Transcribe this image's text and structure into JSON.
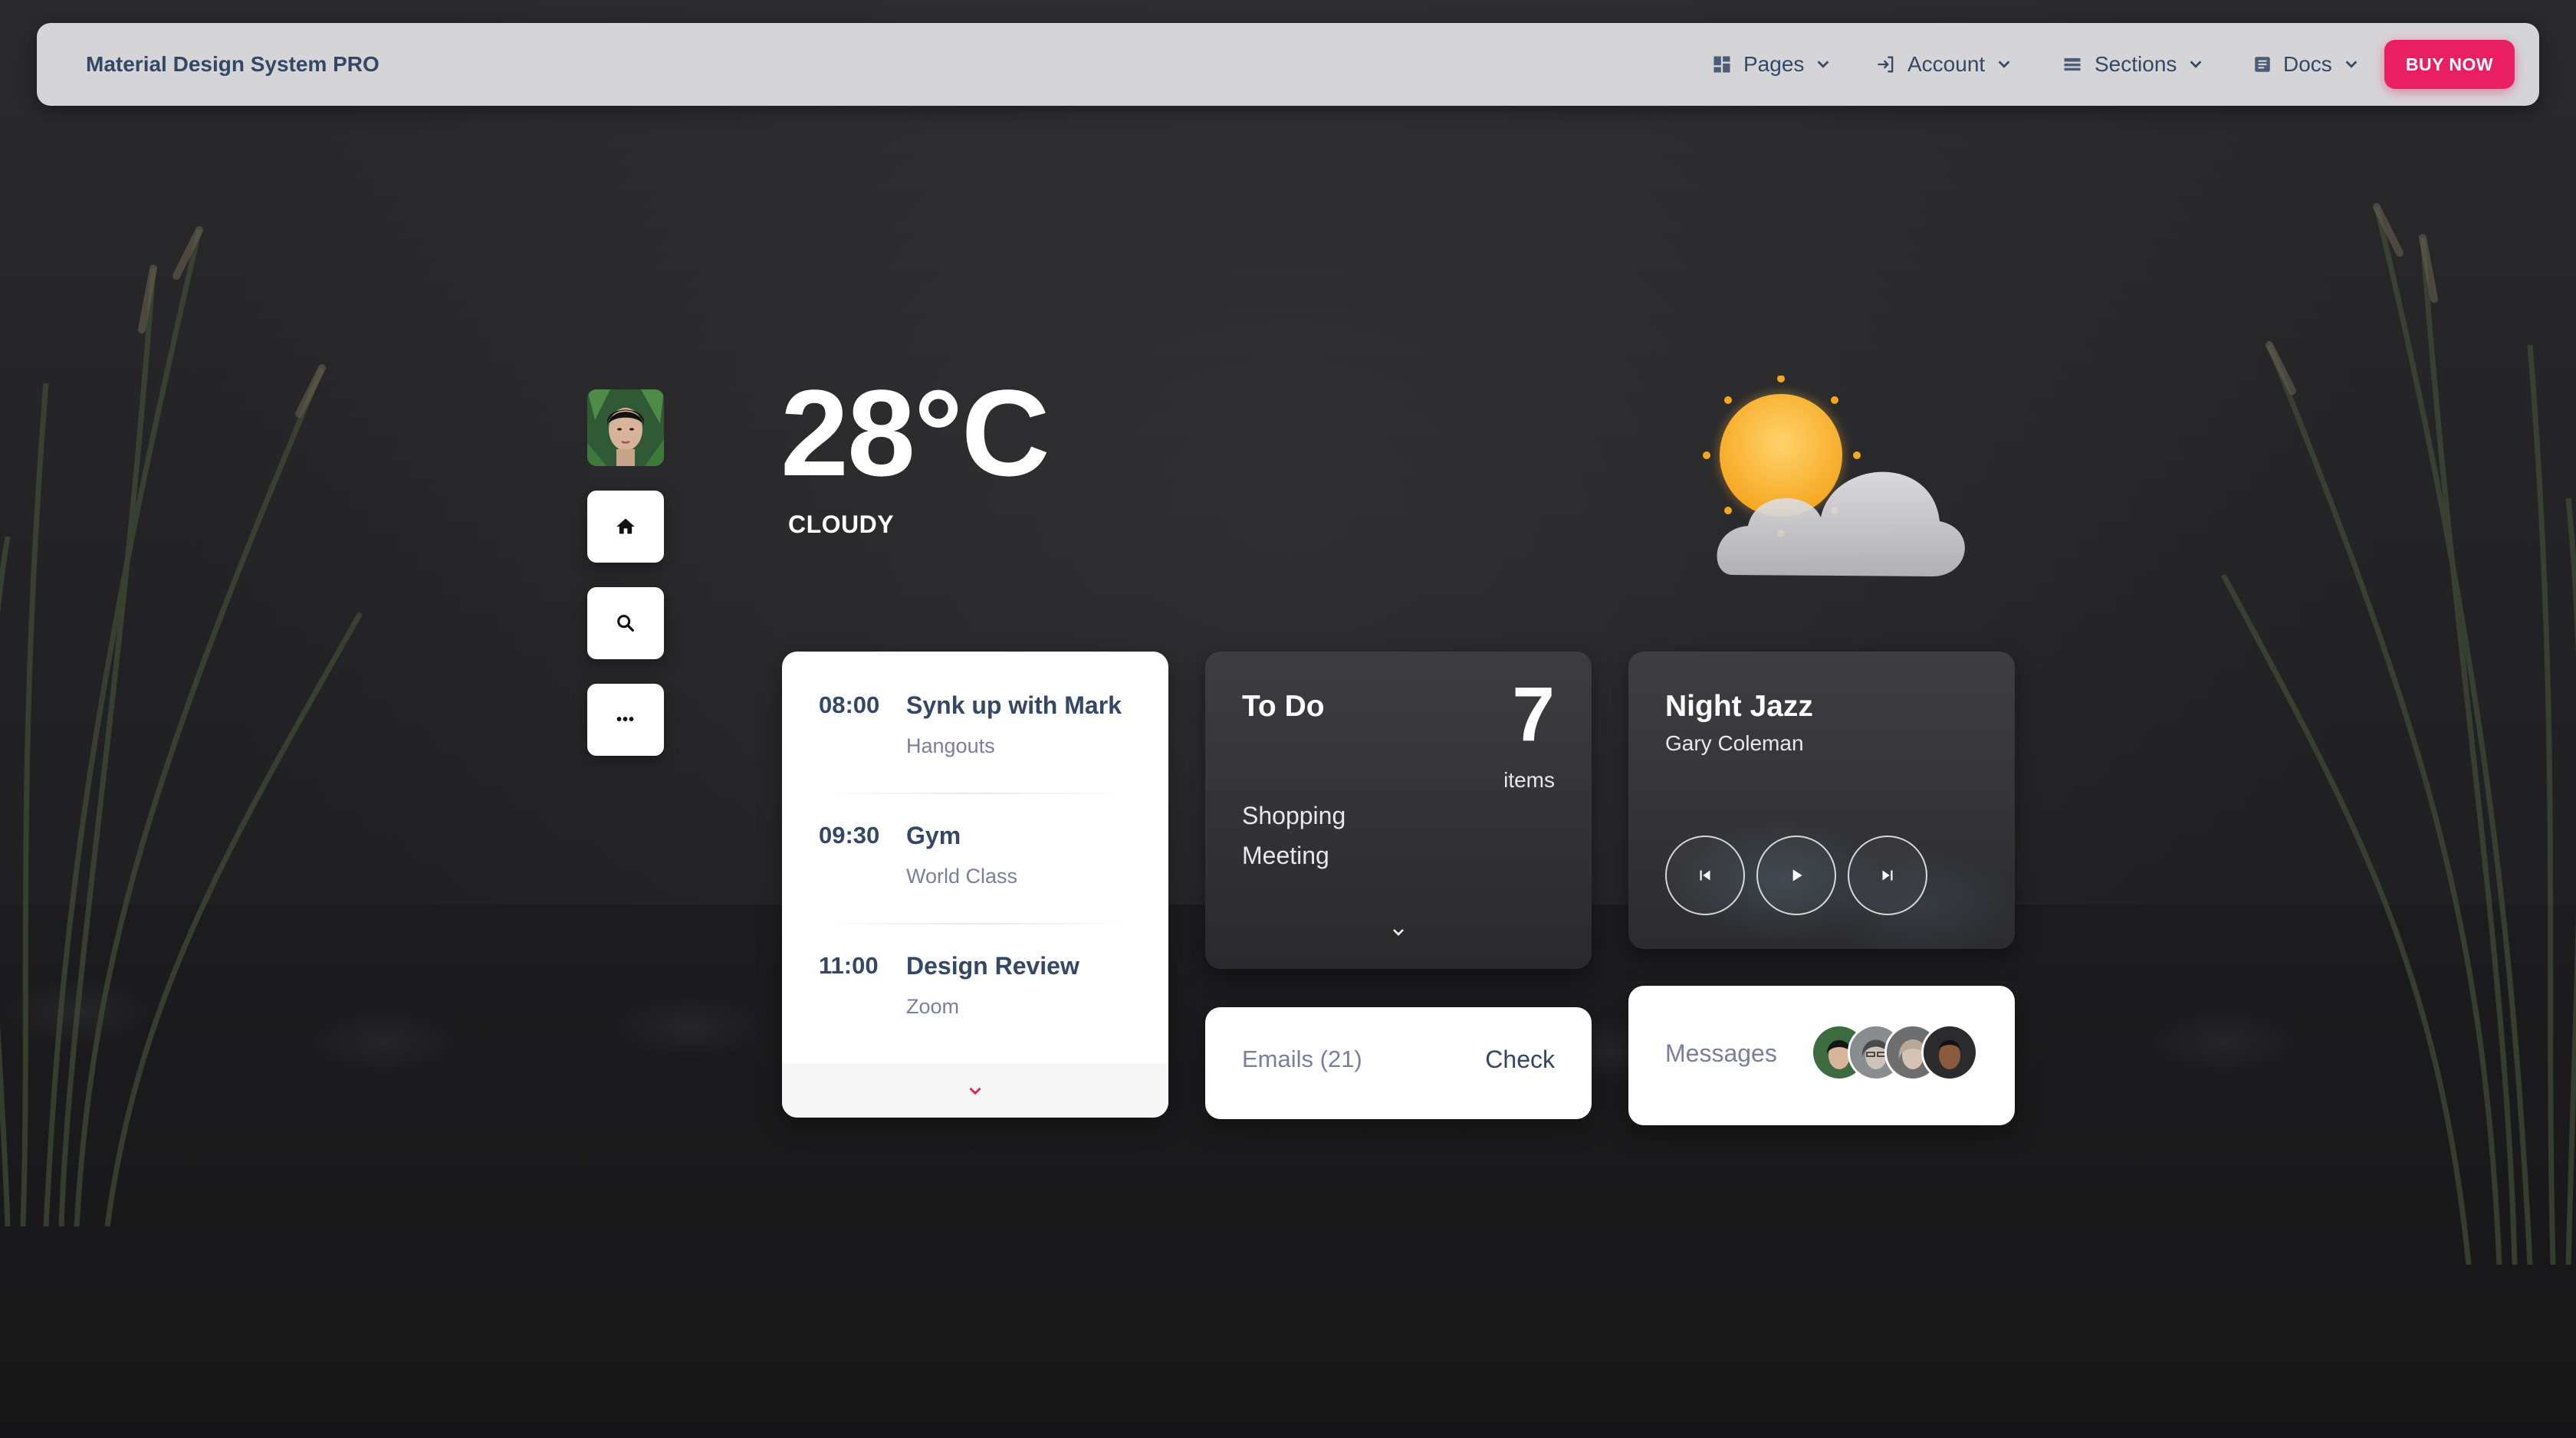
{
  "navbar": {
    "brand": "Material Design System PRO",
    "items": [
      {
        "label": "Pages",
        "icon": "dashboard-icon"
      },
      {
        "label": "Account",
        "icon": "login-icon"
      },
      {
        "label": "Sections",
        "icon": "view-list-icon"
      },
      {
        "label": "Docs",
        "icon": "article-icon"
      }
    ],
    "buy_label": "BUY NOW",
    "accent_color": "#e91e63"
  },
  "sidebar": {
    "buttons": [
      {
        "icon": "home-icon"
      },
      {
        "icon": "search-icon"
      },
      {
        "icon": "more-horizontal-icon",
        "glyph": "•••"
      }
    ]
  },
  "weather": {
    "temperature": "28°C",
    "condition": "CLOUDY",
    "icon": "partly-cloudy-icon"
  },
  "schedule": {
    "events": [
      {
        "time": "08:00",
        "title": "Synk up with Mark",
        "subtitle": "Hangouts"
      },
      {
        "time": "09:30",
        "title": "Gym",
        "subtitle": "World Class"
      },
      {
        "time": "11:00",
        "title": "Design Review",
        "subtitle": "Zoom"
      }
    ]
  },
  "todo": {
    "title": "To Do",
    "count": "7",
    "unit": "items",
    "items": [
      "Shopping",
      "Meeting"
    ]
  },
  "emails": {
    "label": "Emails (21)",
    "action": "Check"
  },
  "music": {
    "title": "Night Jazz",
    "artist": "Gary Coleman",
    "controls": [
      "skip-previous-icon",
      "play-icon",
      "skip-next-icon"
    ]
  },
  "messages": {
    "label": "Messages",
    "avatar_count": 4
  }
}
